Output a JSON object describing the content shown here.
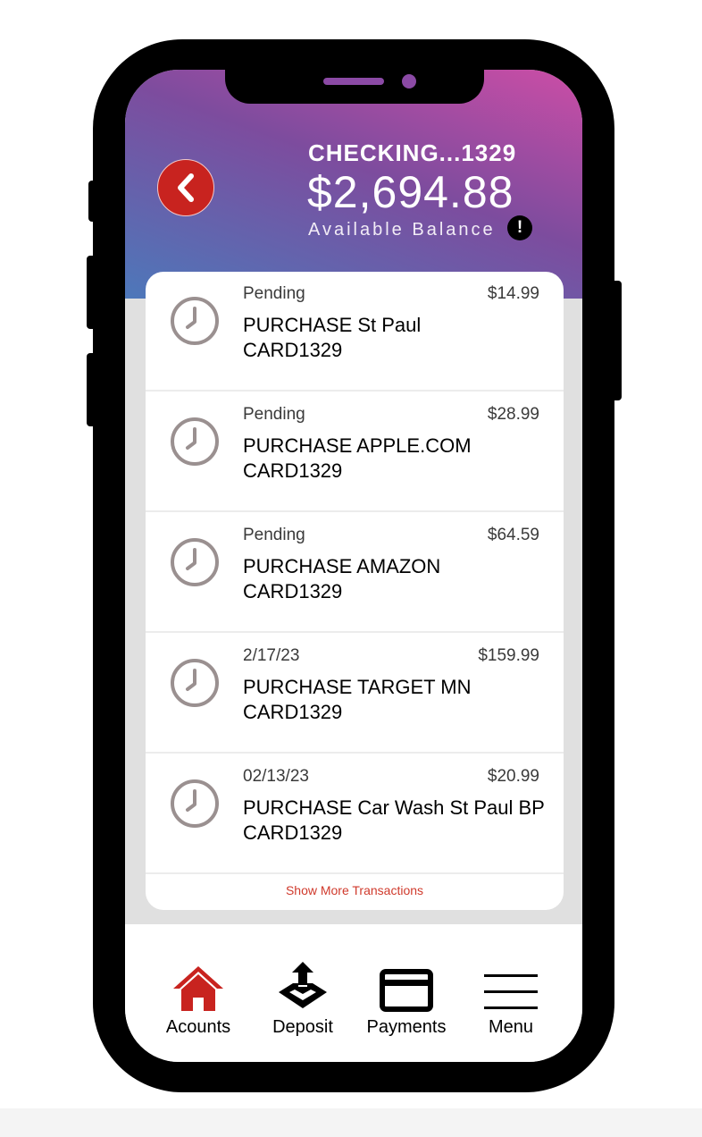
{
  "account": {
    "title": "CHECKING...1329",
    "balance": "$2,694.88",
    "balance_label": "Available Balance",
    "info_glyph": "!"
  },
  "transactions": [
    {
      "status": "Pending",
      "amount": "$14.99",
      "line1": "PURCHASE St Paul",
      "line2": "CARD1329"
    },
    {
      "status": "Pending",
      "amount": "$28.99",
      "line1": "PURCHASE APPLE.COM",
      "line2": "CARD1329"
    },
    {
      "status": "Pending",
      "amount": "$64.59",
      "line1": "PURCHASE AMAZON",
      "line2": "CARD1329"
    },
    {
      "status": "2/17/23",
      "amount": "$159.99",
      "line1": "PURCHASE TARGET MN",
      "line2": "CARD1329"
    },
    {
      "status": "02/13/23",
      "amount": "$20.99",
      "line1": "PURCHASE Car Wash St Paul BP",
      "line2": "CARD1329"
    }
  ],
  "show_more": "Show More Transactions",
  "nav": [
    {
      "label": "Acounts",
      "icon": "home-icon"
    },
    {
      "label": "Deposit",
      "icon": "deposit-upload-icon"
    },
    {
      "label": "Payments",
      "icon": "credit-card-icon"
    },
    {
      "label": "Menu",
      "icon": "hamburger-menu-icon"
    }
  ],
  "colors": {
    "accent_red": "#c8231f",
    "header_gradient": [
      "#cc4da6",
      "#7d4c9e",
      "#4d78ba"
    ],
    "link_red": "#d03a2c"
  }
}
